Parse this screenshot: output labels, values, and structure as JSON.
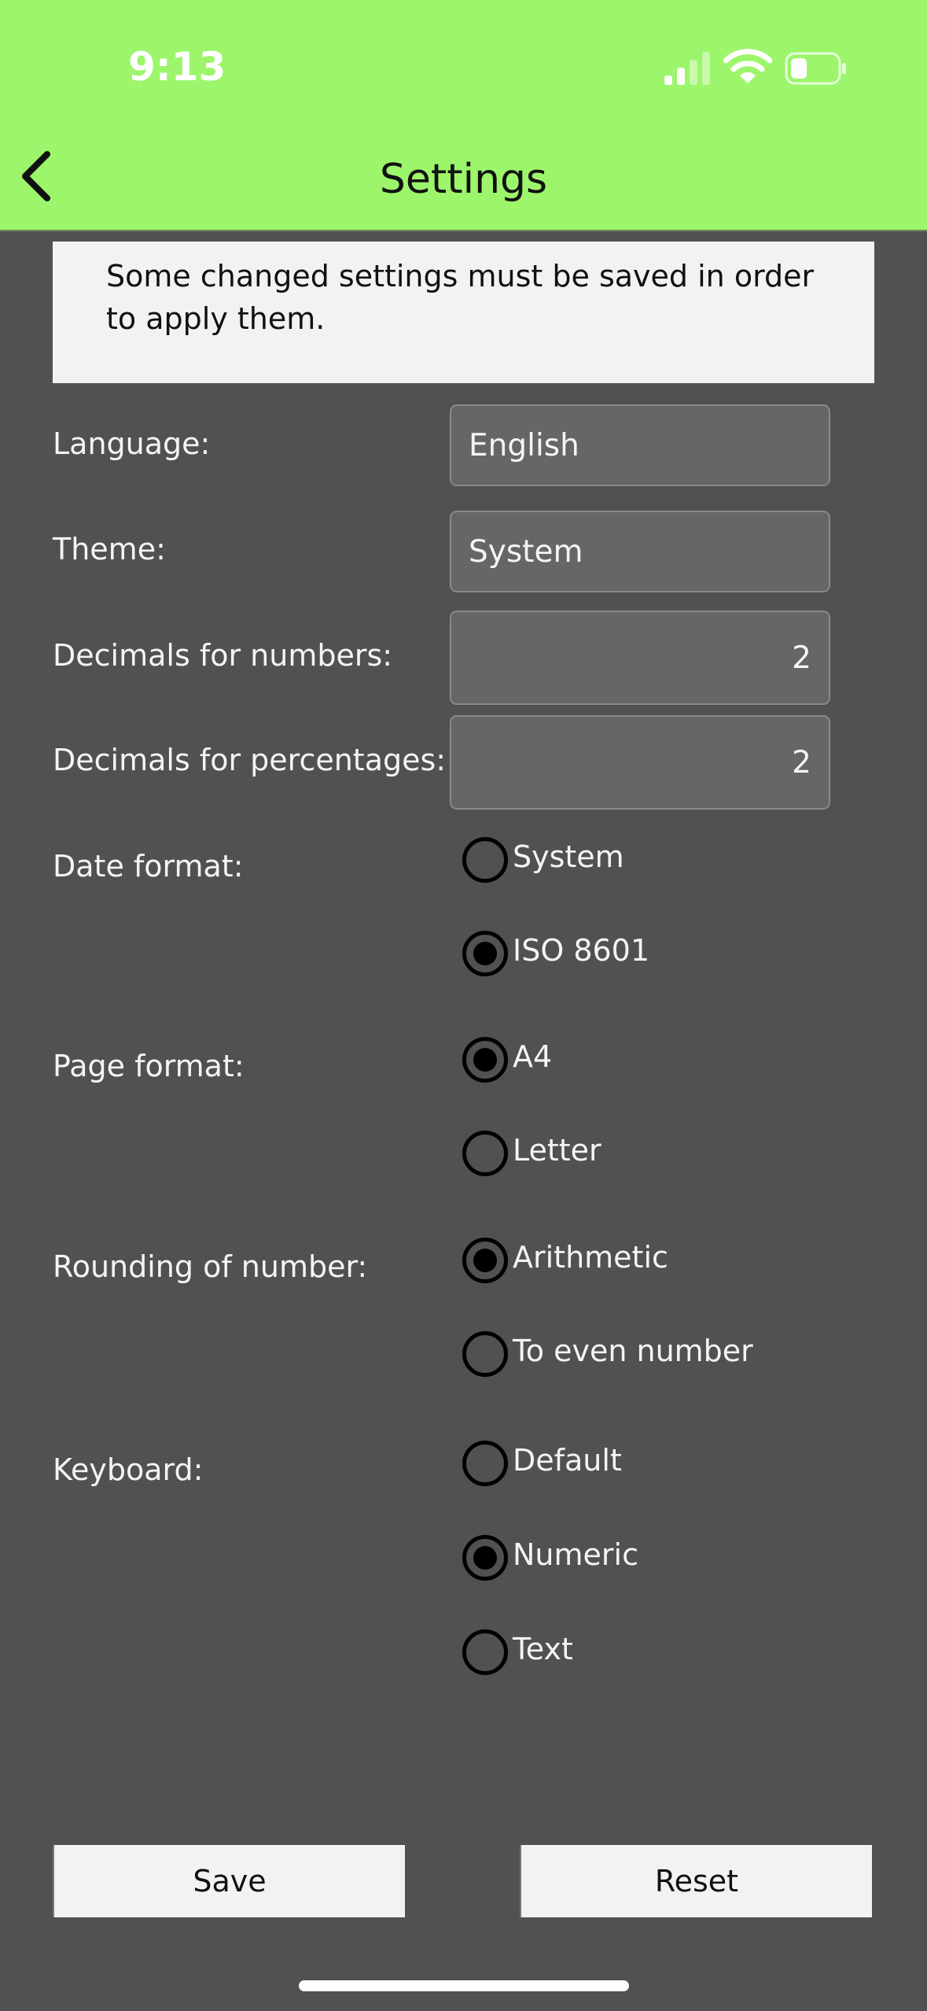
{
  "status": {
    "time": "9:13"
  },
  "header": {
    "title": "Settings"
  },
  "notice": "Some changed settings must be saved in order to apply them.",
  "language": {
    "label": "Language:",
    "value": "English"
  },
  "theme": {
    "label": "Theme:",
    "value": "System"
  },
  "decimals_numbers": {
    "label": "Decimals for numbers:",
    "value": "2"
  },
  "decimals_percentages": {
    "label": "Decimals for percentages:",
    "value": "2"
  },
  "date_format": {
    "label": "Date format:",
    "options": [
      "System",
      "ISO 8601"
    ],
    "selected": "ISO 8601"
  },
  "page_format": {
    "label": "Page format:",
    "options": [
      "A4",
      "Letter"
    ],
    "selected": "A4"
  },
  "rounding": {
    "label": "Rounding of number:",
    "options": [
      "Arithmetic",
      "To even number"
    ],
    "selected": "Arithmetic"
  },
  "keyboard": {
    "label": "Keyboard:",
    "options": [
      "Default",
      "Numeric",
      "Text"
    ],
    "selected": "Numeric"
  },
  "buttons": {
    "save": "Save",
    "reset": "Reset"
  },
  "colors": {
    "header": "#9cf56b",
    "background": "#515151",
    "field": "#666666",
    "panel": "#f2f2f2"
  }
}
